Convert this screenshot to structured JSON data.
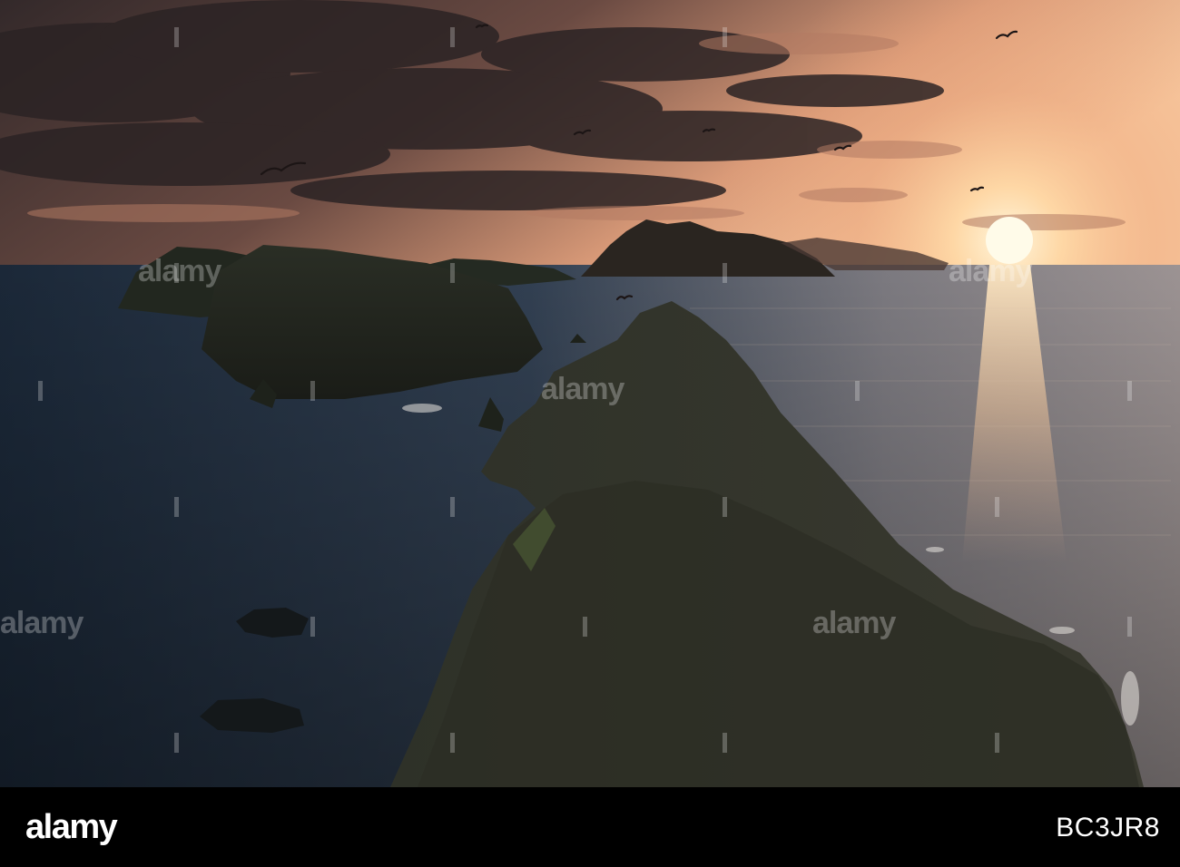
{
  "photo": {
    "subject": "sunset over rocky islands and ocean with flying seabirds",
    "colors": {
      "sky_top": "#3a2f2d",
      "sky_mid": "#8a6150",
      "sky_glow": "#f2b48a",
      "sun": "#fff3d6",
      "sea_dark": "#1d2b3b",
      "sea_light": "#8f8c8c",
      "rock_dark": "#1f241d",
      "rock_mid": "#323628"
    }
  },
  "watermark": {
    "text": "alamy"
  },
  "footer": {
    "logo_text": "alamy",
    "image_id": "BC3JR8",
    "background": "#000000"
  }
}
